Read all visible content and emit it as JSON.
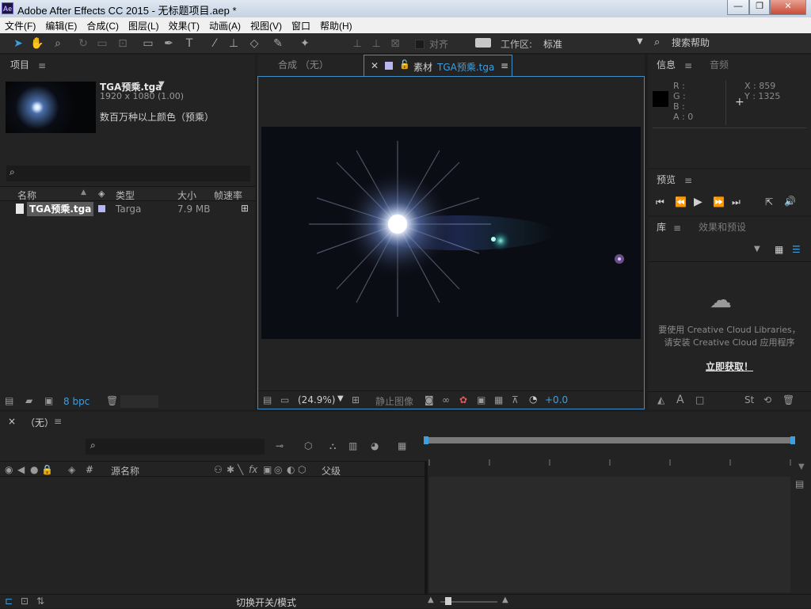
{
  "window": {
    "app_badge": "Ae",
    "title": "Adobe After Effects CC 2015 - 无标题项目.aep *",
    "minimize": "—",
    "maximize": "❐",
    "close": "✕"
  },
  "menu": [
    "文件(F)",
    "编辑(E)",
    "合成(C)",
    "图层(L)",
    "效果(T)",
    "动画(A)",
    "视图(V)",
    "窗口",
    "帮助(H)"
  ],
  "toolbar": {
    "snap_label": "对齐",
    "workspace_label": "工作区:",
    "workspace_value": "标准",
    "search_help": "搜索帮助"
  },
  "project": {
    "tab": "项目",
    "file_name": "TGA预乘.tga",
    "dimensions": "1920 x 1080 (1.00)",
    "color_depth": "数百万种以上颜色（预乘）",
    "columns": {
      "name": "名称",
      "type": "类型",
      "size": "大小",
      "fps": "帧速率"
    },
    "rows": [
      {
        "name": "TGA预乘.tga",
        "type": "Targa",
        "size": "7.9 MB"
      }
    ],
    "bpc": "8 bpc"
  },
  "viewer": {
    "tab_comp": "合成 （无）",
    "tab_footage_prefix": "素材",
    "tab_footage_file": "TGA预乘.tga",
    "zoom": "(24.9%)",
    "freeze_label": "静止图像",
    "exposure": "+0.0"
  },
  "info": {
    "tab_info": "信息",
    "tab_audio": "音频",
    "r": "R :",
    "g": "G :",
    "b": "B :",
    "a": "A : 0",
    "x": "X : 859",
    "y": "Y : 1325"
  },
  "preview": {
    "tab": "预览"
  },
  "library": {
    "tab_library": "库",
    "tab_effects": "效果和预设",
    "message_line1": "要使用 Creative Cloud Libraries，",
    "message_line2": "请安装 Creative Cloud 应用程序",
    "get_link": "立即获取！"
  },
  "timeline": {
    "close": "×",
    "tab": "（无）",
    "col_source": "源名称",
    "col_parent": "父级",
    "col_hash": "#",
    "toggle_label": "切换开关/模式"
  },
  "colors": {
    "accent_blue": "#3d9fe0",
    "panel_bg": "#232323",
    "app_bg": "#1e1e1e"
  }
}
